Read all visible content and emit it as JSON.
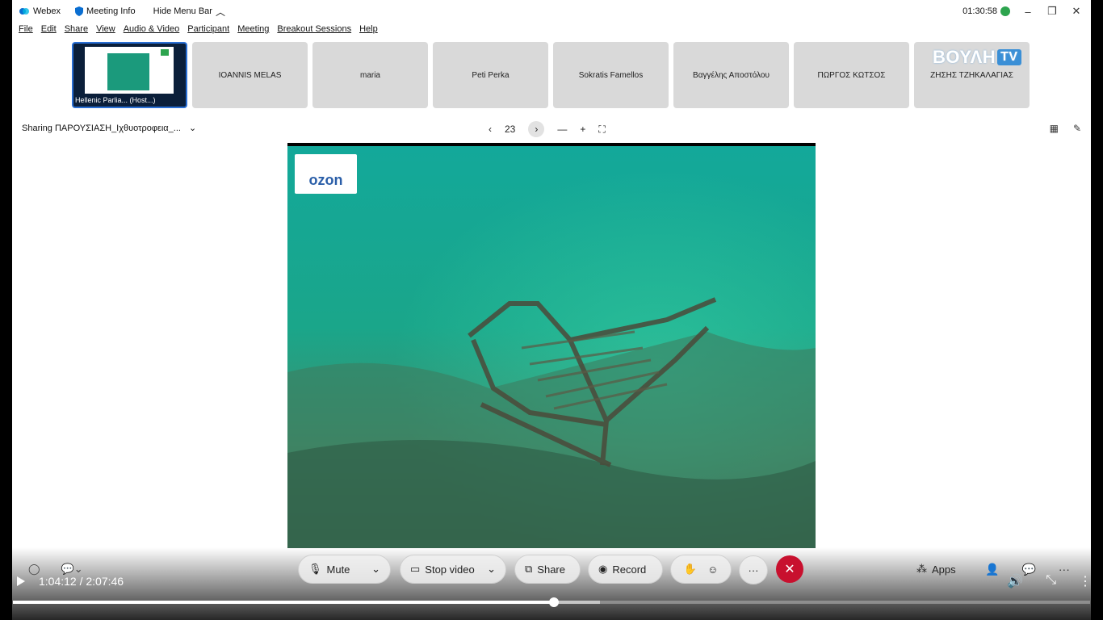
{
  "titlebar": {
    "app_name": "Webex",
    "meeting_info": "Meeting Info",
    "hide_menu_bar": "Hide Menu Bar",
    "timer": "01:30:58"
  },
  "menu": [
    "File",
    "Edit",
    "Share",
    "View",
    "Audio & Video",
    "Participant",
    "Meeting",
    "Breakout Sessions",
    "Help"
  ],
  "participants": {
    "host_label": "Hellenic Parlia... (Host...)",
    "names": [
      "IOANNIS MELAS",
      "maria",
      "Peti Perka",
      "Sokratis Famellos",
      "Βαγγέλης Αποστόλου",
      "ΠΩΡΓΟΣ ΚΩΤΣΟΣ",
      "ΖΗΣΗΣ ΤΖΗΚΑΛΑΓΙΑΣ"
    ]
  },
  "channel_logo": {
    "name": "ΒΟΥΛΗ",
    "tag": "TV"
  },
  "sharing": {
    "label": "Sharing ΠΑΡΟΥΣΙΑΣΗ_Ιχθυοτροφεια_...",
    "page": "23"
  },
  "slide": {
    "logo_text": "ozon"
  },
  "toolbar": {
    "mute": "Mute",
    "stop_video": "Stop video",
    "share": "Share",
    "record": "Record",
    "apps": "Apps"
  },
  "player": {
    "time": "1:04:12 / 2:07:46",
    "progress_played": 0.502,
    "progress_buffered": 0.545
  },
  "colors": {
    "end_call": "#c8102e",
    "progress": "#ffffff",
    "active_tile_border": "#2a6fd4"
  }
}
